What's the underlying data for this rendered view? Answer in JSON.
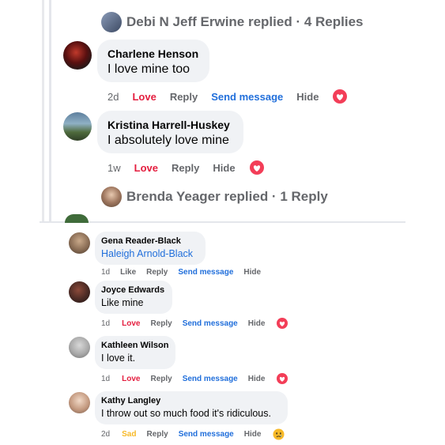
{
  "top_section": {
    "replied_1": {
      "text": "Debi N Jeff Erwine replied · 4 Replies"
    },
    "comments": [
      {
        "name": "Charlene Henson",
        "message": "I love mine too",
        "time": "2d",
        "reaction_label": "Love",
        "reply": "Reply",
        "send_message": "Send message",
        "hide": "Hide",
        "reaction_icon": "love-heart-icon"
      },
      {
        "name": "Kristina Harrell-Huskey",
        "message": "I absolutely love mine",
        "time": "1w",
        "reaction_label": "Love",
        "reply": "Reply",
        "hide": "Hide",
        "reaction_icon": "love-heart-icon"
      }
    ],
    "replied_2": {
      "text": "Brenda Yeager replied · 1 Reply"
    }
  },
  "bottom_section": {
    "comments": [
      {
        "name": "Gena Reader-Black",
        "message": "Haleigh Arnold-Black",
        "time": "1d",
        "reaction_label": "Like",
        "reply": "Reply",
        "send_message": "Send message",
        "hide": "Hide"
      },
      {
        "name": "Joyce Edwards",
        "message": "Like mine",
        "time": "1d",
        "reaction_label": "Love",
        "reply": "Reply",
        "send_message": "Send message",
        "hide": "Hide",
        "reaction_icon": "love-heart-icon"
      },
      {
        "name": "Kathleen Wilson",
        "message": "I love it.",
        "time": "1d",
        "reaction_label": "Love",
        "reply": "Reply",
        "send_message": "Send message",
        "hide": "Hide",
        "reaction_icon": "love-heart-icon"
      },
      {
        "name": "Kathy Langley",
        "message": "I throw out so much food it's ridiculous.",
        "time": "2d",
        "reaction_label": "Sad",
        "reply": "Reply",
        "send_message": "Send message",
        "hide": "Hide",
        "reaction_icon": "sad-face-icon"
      }
    ]
  },
  "colors": {
    "love": "#e41e3f",
    "link": "#216fdb",
    "sad": "#f7b928",
    "bubble": "#f0f2f5",
    "muted": "#65676b"
  }
}
